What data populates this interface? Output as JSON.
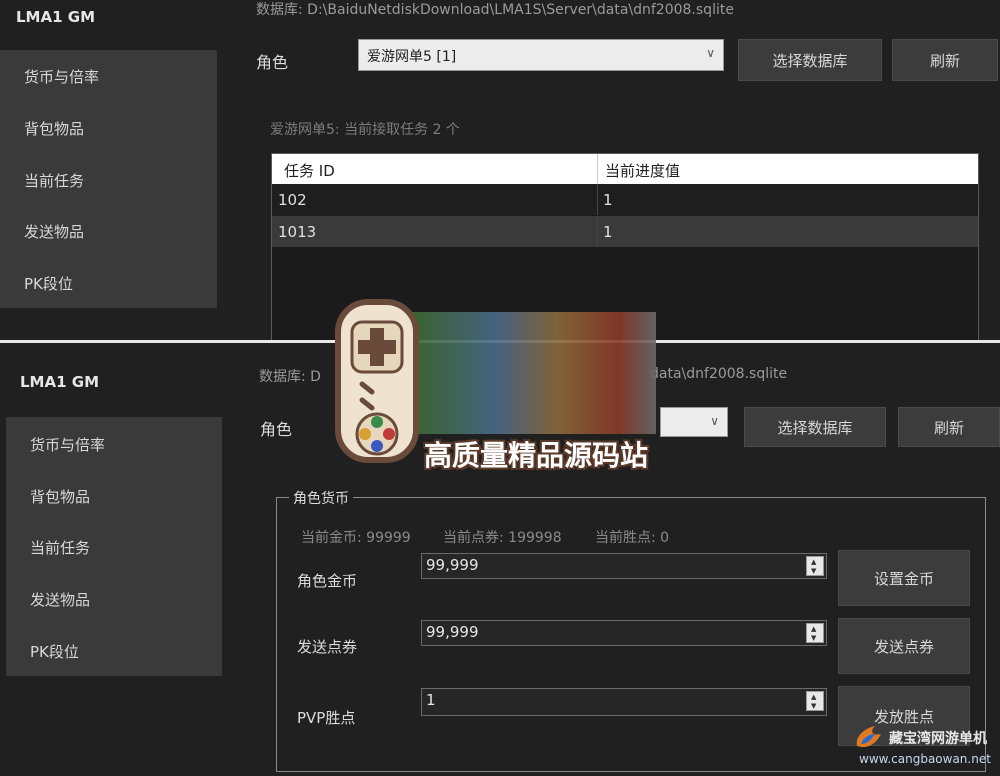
{
  "top": {
    "app_title": "LMA1 GM",
    "db_path": "数据库: D:\\BaiduNetdiskDownload\\LMA1S\\Server\\data\\dnf2008.sqlite",
    "sidebar": [
      "货币与倍率",
      "背包物品",
      "当前任务",
      "发送物品",
      "PK段位"
    ],
    "role_label": "角色",
    "role_selected": "爱游网单5 [1]",
    "select_db_button": "选择数据库",
    "refresh_button": "刷新",
    "task_info": "爱游网单5: 当前接取任务 2 个",
    "table": {
      "headers": [
        "任务 ID",
        "当前进度值"
      ],
      "rows": [
        [
          "102",
          "1"
        ],
        [
          "1013",
          "1"
        ]
      ]
    }
  },
  "bottom": {
    "app_title": "LMA1 GM",
    "db_path_prefix": "数据库: D",
    "db_path_suffix": "data\\dnf2008.sqlite",
    "sidebar": [
      "货币与倍率",
      "背包物品",
      "当前任务",
      "发送物品",
      "PK段位"
    ],
    "role_label": "角色",
    "select_db_button": "选择数据库",
    "refresh_button": "刷新",
    "currency_group": {
      "title": "角色货币",
      "current_gold": "当前金币: 99999",
      "current_points": "当前点券: 199998",
      "current_wins": "当前胜点: 0",
      "gold_label": "角色金币",
      "gold_value": "99,999",
      "set_gold_button": "设置金币",
      "points_label": "发送点券",
      "points_value": "99,999",
      "send_points_button": "发送点券",
      "pvp_label": "PVP胜点",
      "pvp_value": "1",
      "send_wins_button": "发放胜点"
    }
  },
  "overlay": {
    "site_text": "高质量精品源码站"
  },
  "watermark": {
    "name": "藏宝湾网游单机",
    "url": "www.cangbaowan.net"
  }
}
